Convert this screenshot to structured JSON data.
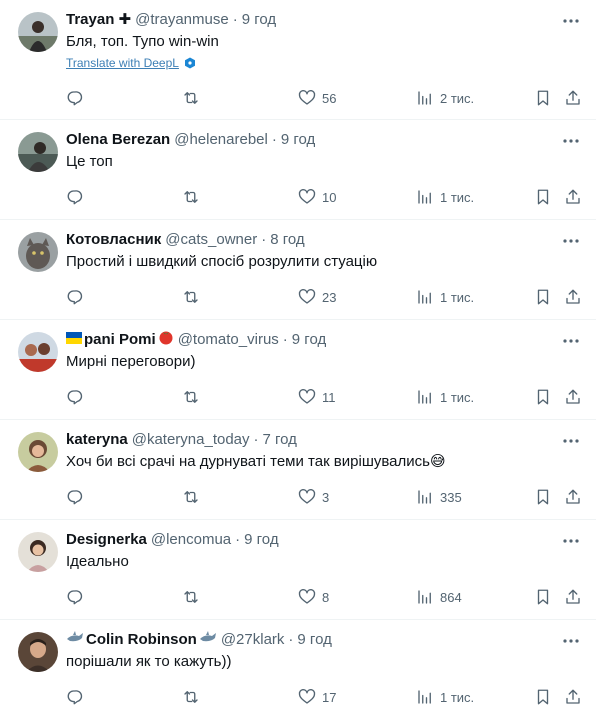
{
  "colors": {
    "text": "#0f1419",
    "secondary": "#536471",
    "link": "#1d9bf0",
    "border": "#eff3f4"
  },
  "tweets": [
    {
      "name": "Trayan ✚",
      "handle": "@trayanmuse",
      "sep": "·",
      "time": "9 год",
      "text": "Бля, топ. Тупо win-win",
      "translate": "Translate with DeepL",
      "reply": "",
      "retweet": "",
      "like": "56",
      "views": "2 тис."
    },
    {
      "name": "Olena Berezan",
      "handle": "@helenarebel",
      "sep": "·",
      "time": "9 год",
      "text": "Це топ",
      "reply": "",
      "retweet": "",
      "like": "10",
      "views": "1 тис."
    },
    {
      "name": "Котовласник",
      "handle": "@cats_owner",
      "sep": "·",
      "time": "8 год",
      "text": "Простий і швидкий спосіб розрулити стуацію",
      "reply": "",
      "retweet": "",
      "like": "23",
      "views": "1 тис."
    },
    {
      "name": "pani Pomi",
      "handle": "@tomato_virus",
      "sep": "·",
      "time": "9 год",
      "text": "Мирні переговори)",
      "reply": "",
      "retweet": "",
      "like": "11",
      "views": "1 тис."
    },
    {
      "name": "kateryna",
      "handle": "@kateryna_today",
      "sep": "·",
      "time": "7 год",
      "text": "Хоч би всі срачі на дурнуваті теми так вирішувались😅",
      "reply": "",
      "retweet": "",
      "like": "3",
      "views": "335"
    },
    {
      "name": "Designerka",
      "handle": "@lencomua",
      "sep": "·",
      "time": "9 год",
      "text": "Ідеально",
      "reply": "",
      "retweet": "",
      "like": "8",
      "views": "864"
    },
    {
      "name": "Colin Robinson",
      "handle": "@27klark",
      "sep": "·",
      "time": "9 год",
      "text": "порішали як то кажуть))",
      "reply": "",
      "retweet": "",
      "like": "17",
      "views": "1 тис."
    }
  ]
}
